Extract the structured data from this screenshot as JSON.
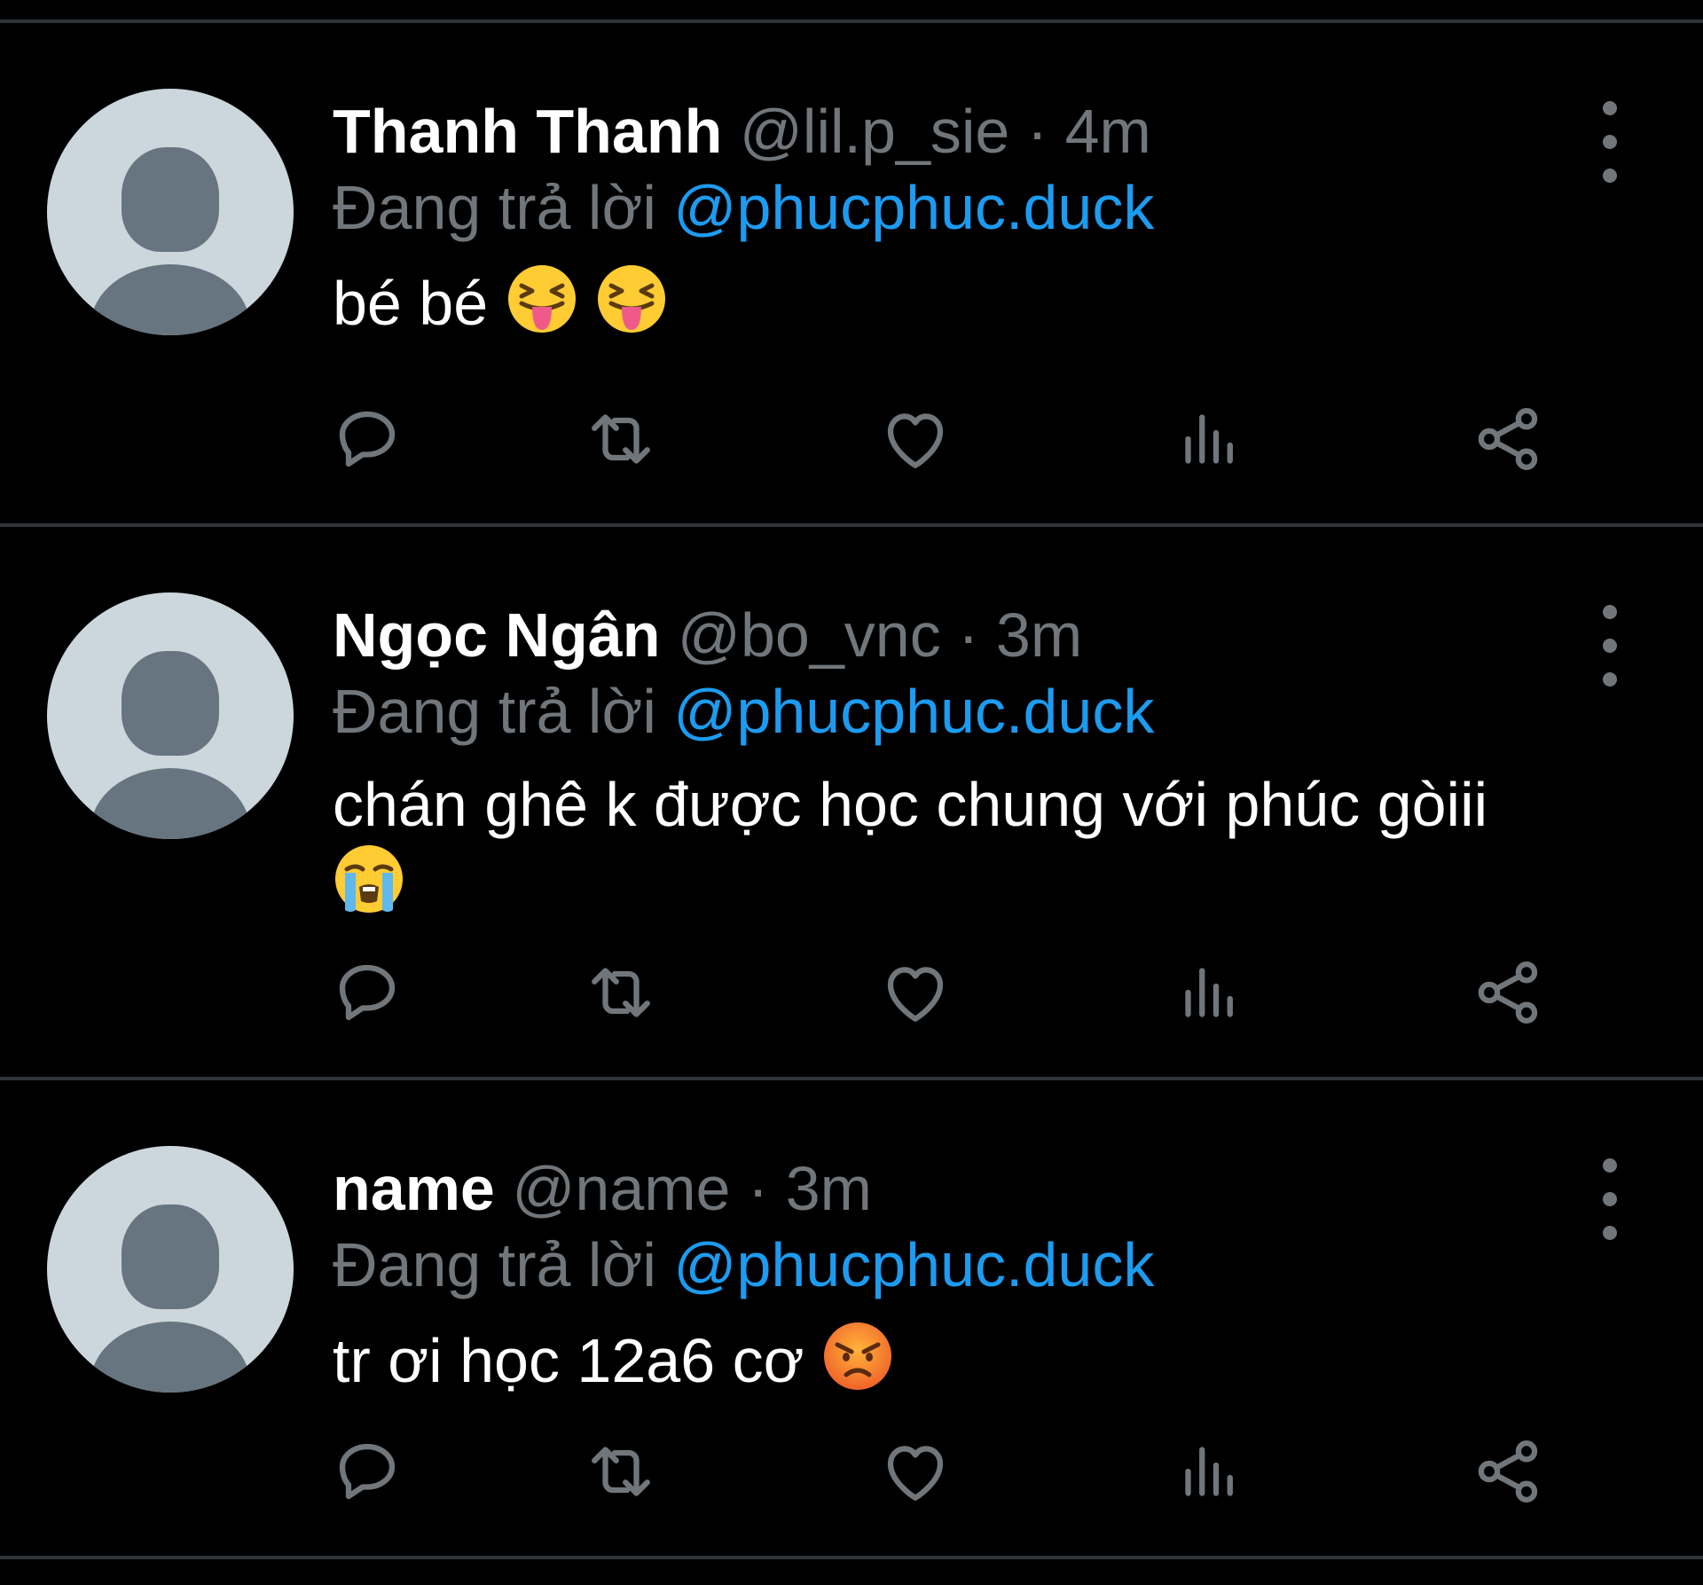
{
  "theme": {
    "background": "#000000",
    "divider": "#2f3336",
    "primary_text": "#ffffff",
    "secondary_text": "#71767b",
    "accent": "#1d9bf0",
    "avatar_bg": "#ccd6dd",
    "avatar_fg": "#66757f"
  },
  "tweets": [
    {
      "display_name": "Thanh Thanh",
      "handle": "@lil.p_sie",
      "separator": "·",
      "time": "4m",
      "reply_prefix": "Đang trả lời",
      "reply_to": "@phucphuc.duck",
      "text": "bé bé",
      "emojis": [
        "squinting-face-with-tongue-emoji",
        "squinting-face-with-tongue-emoji"
      ]
    },
    {
      "display_name": "Ngọc Ngân",
      "handle": "@bo_vnc",
      "separator": "·",
      "time": "3m",
      "reply_prefix": "Đang trả lời",
      "reply_to": "@phucphuc.duck",
      "text": "chán ghê k được học chung với phúc gòiii",
      "emojis": [
        "loudly-crying-face-emoji"
      ]
    },
    {
      "display_name": "name",
      "handle": "@name",
      "separator": "·",
      "time": "3m",
      "reply_prefix": "Đang trả lời",
      "reply_to": "@phucphuc.duck",
      "text": "tr ơi học 12a6 cơ",
      "emojis": [
        "pouting-face-emoji"
      ]
    }
  ],
  "action_icons": [
    "reply-icon",
    "retweet-icon",
    "like-icon",
    "views-icon",
    "share-icon"
  ],
  "more_icon": "more-vertical-icon"
}
